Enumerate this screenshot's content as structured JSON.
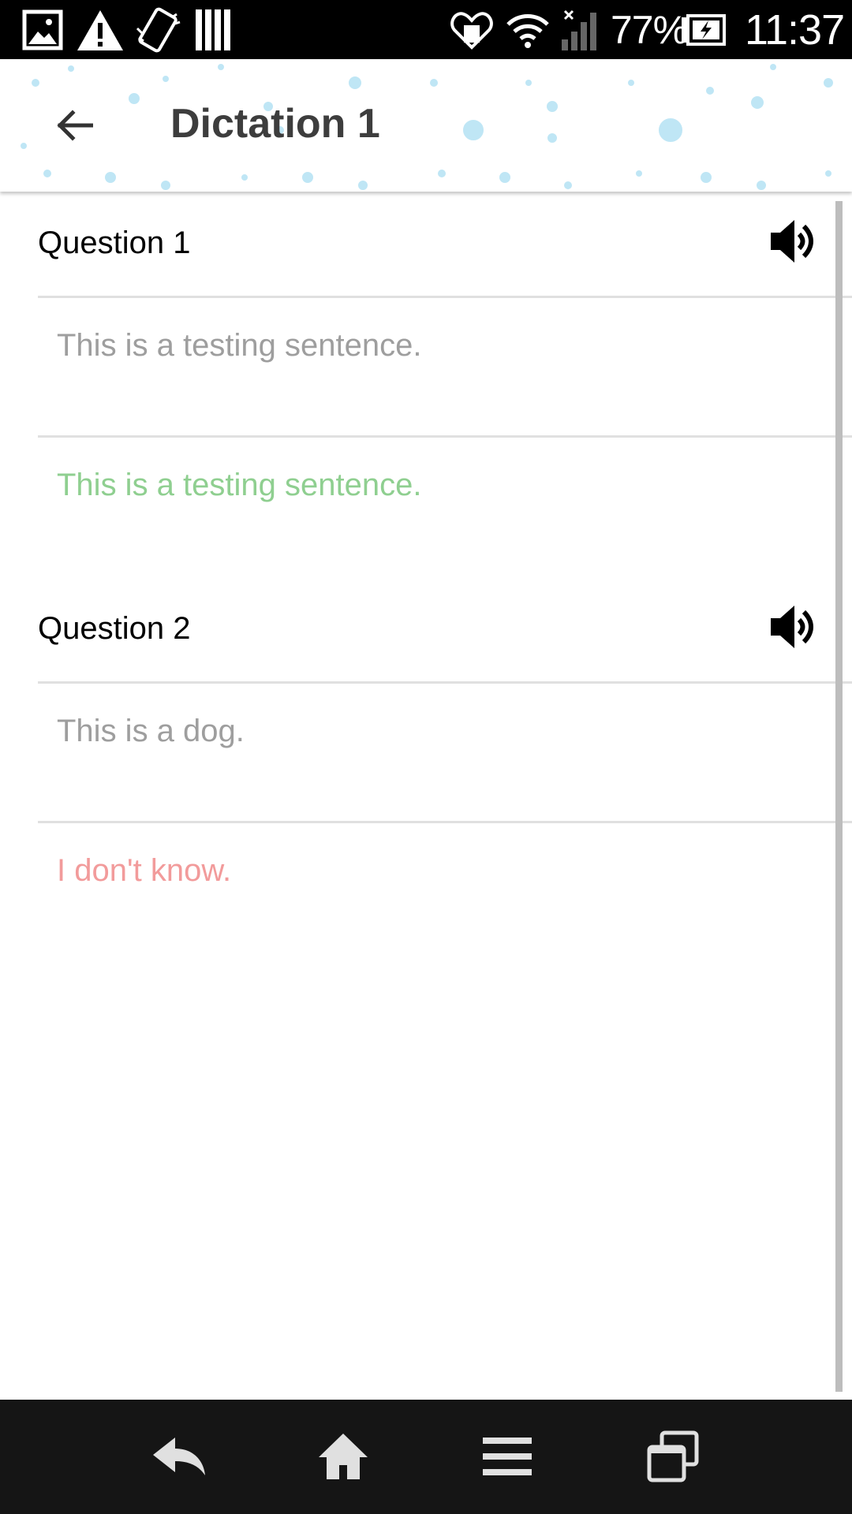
{
  "status_bar": {
    "battery_percent": "77%",
    "time": "11:37",
    "icons": [
      "gallery-icon",
      "warning-icon",
      "vibrate-icon",
      "cards-icon",
      "heart-monitor-icon",
      "wifi-icon",
      "signal-icon",
      "battery-charging-icon"
    ]
  },
  "app_bar": {
    "title": "Dictation 1",
    "back_icon": "arrow-back-icon"
  },
  "questions": [
    {
      "title": "Question 1",
      "speaker_icon": "volume-icon",
      "user_answer": "This is a testing sentence.",
      "result_text": "This is a testing sentence.",
      "result_status": "correct",
      "result_color": "#8fcf90"
    },
    {
      "title": "Question 2",
      "speaker_icon": "volume-icon",
      "user_answer": "This is a dog.",
      "result_text": "I don't know.",
      "result_status": "wrong",
      "result_color": "#f29b9b"
    }
  ],
  "nav_bar": {
    "icons": [
      "nav-back-icon",
      "home-icon",
      "menu-icon",
      "recent-apps-icon"
    ]
  },
  "colors": {
    "status_bar_bg": "#000000",
    "nav_bar_bg": "#151515",
    "title_text": "#3d3d3d",
    "answer_text": "#9e9e9e",
    "divider": "#e0e0e0",
    "snowflake": "#bfe6f5"
  }
}
